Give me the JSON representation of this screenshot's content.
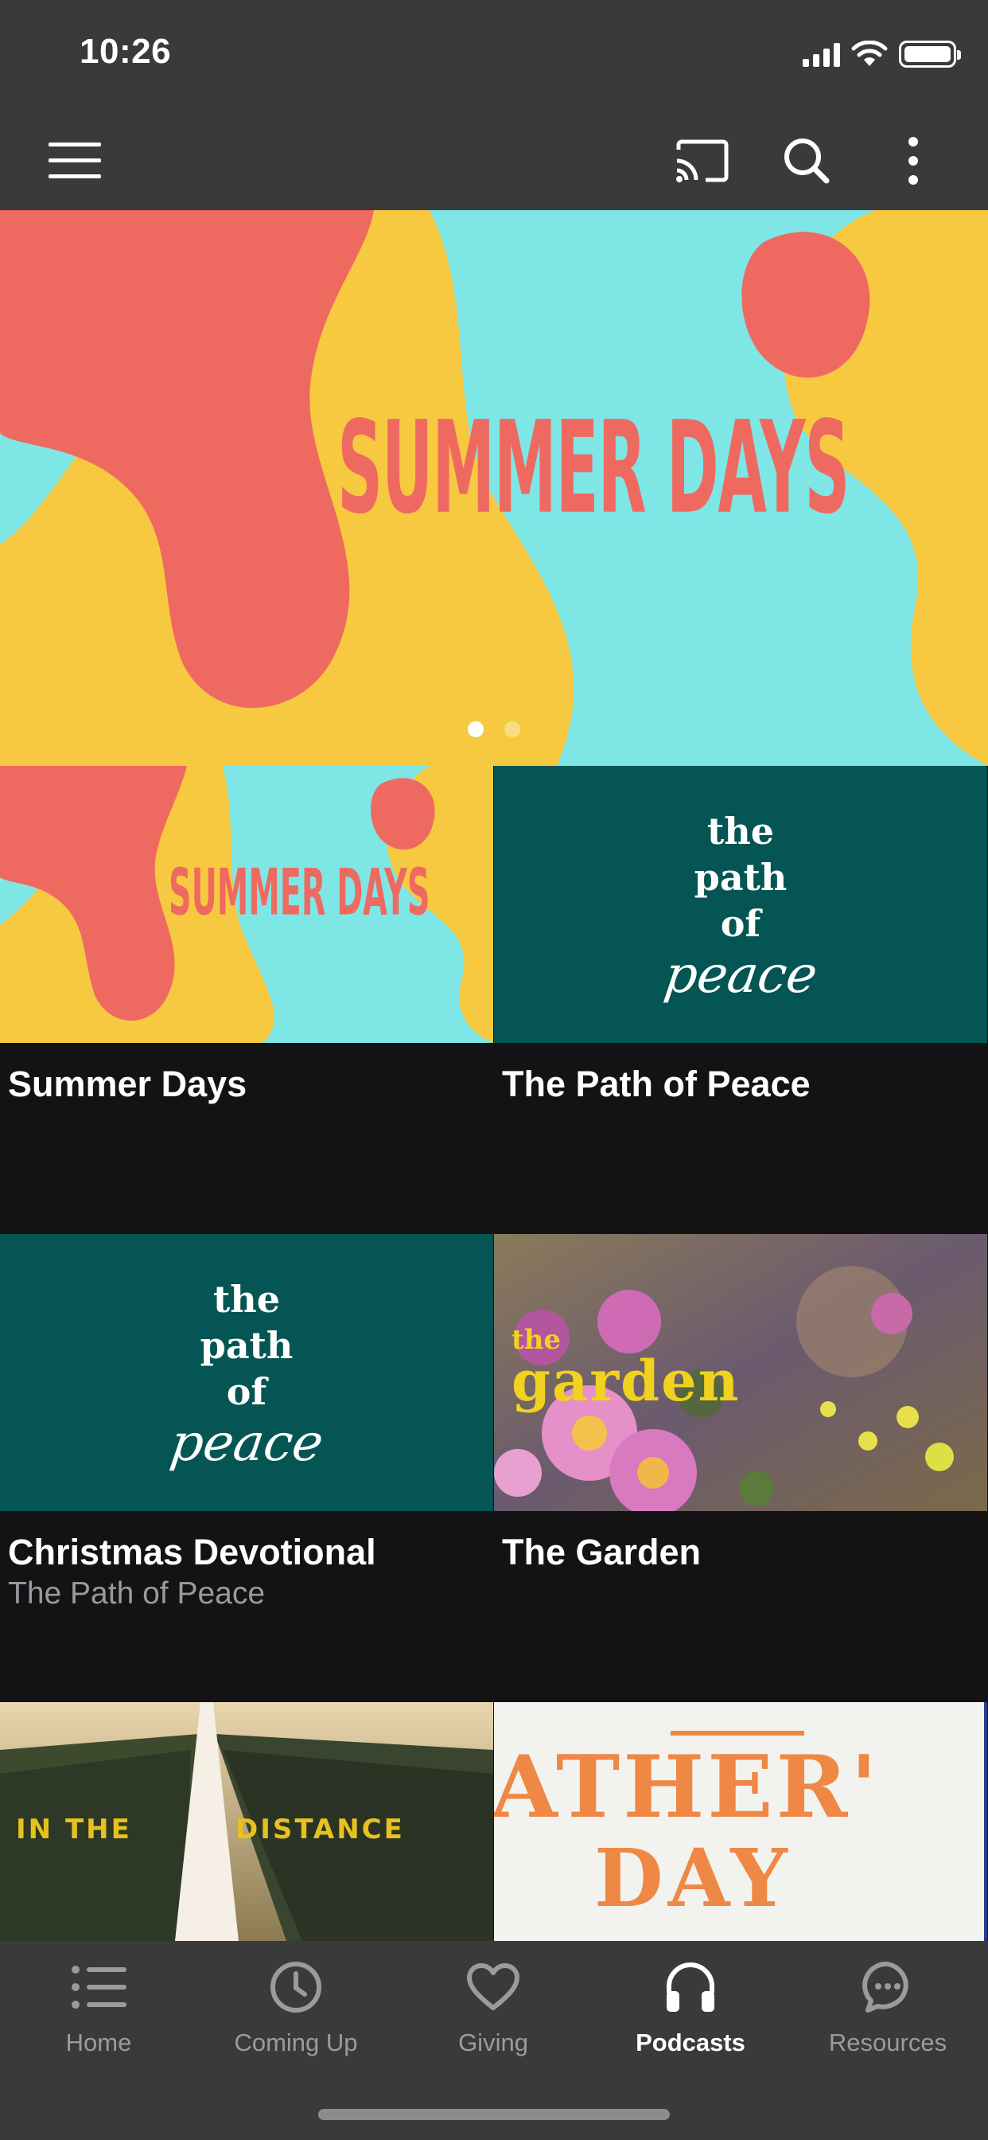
{
  "status_bar": {
    "time": "10:26"
  },
  "app_bar": {
    "menu_icon": "hamburger-menu-icon",
    "cast_icon": "cast-icon",
    "search_icon": "search-icon",
    "more_icon": "more-vertical-icon"
  },
  "hero": {
    "banner_text": "SUMMER DAYS",
    "pages": 2,
    "active_page": 1,
    "colors": {
      "aqua": "#7fe6e6",
      "yellow": "#f7c940",
      "coral": "#ee6a60"
    }
  },
  "grid": {
    "items": [
      {
        "title": "Summer Days",
        "subtitle": "",
        "art_text": "SUMMER DAYS"
      },
      {
        "title": "The Path of Peace",
        "subtitle": "",
        "art_text": [
          "the",
          "path",
          "of",
          "peace"
        ]
      },
      {
        "title": "Christmas Devotional",
        "subtitle": "The Path of Peace",
        "art_text": [
          "the",
          "path",
          "of",
          "peace"
        ]
      },
      {
        "title": "The Garden",
        "subtitle": "",
        "art_text": [
          "the",
          "garden"
        ]
      },
      {
        "title": "",
        "subtitle": "",
        "art_text": [
          "IN THE",
          "DISTANCE"
        ]
      },
      {
        "title": "",
        "subtitle": "",
        "art_text": [
          "ATHER'",
          "DAY"
        ]
      }
    ]
  },
  "tab_bar": {
    "tabs": [
      {
        "label": "Home",
        "icon": "list-icon"
      },
      {
        "label": "Coming Up",
        "icon": "clock-icon"
      },
      {
        "label": "Giving",
        "icon": "heart-icon"
      },
      {
        "label": "Podcasts",
        "icon": "headphones-icon",
        "active": true
      },
      {
        "label": "Resources",
        "icon": "chat-bubble-icon"
      }
    ],
    "colors": {
      "active": "#ffffff",
      "inactive": "#9b9b9b"
    }
  }
}
